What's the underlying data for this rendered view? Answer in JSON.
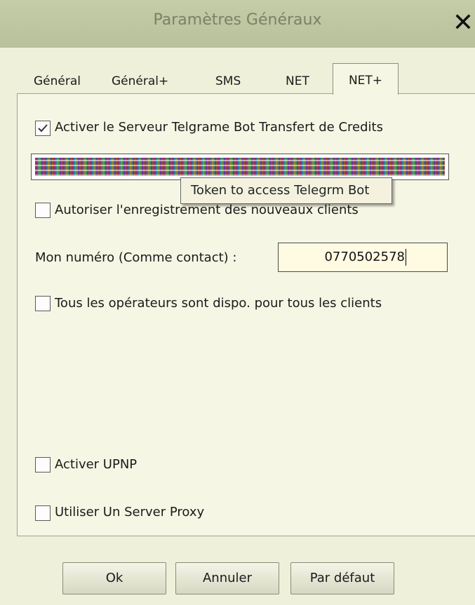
{
  "window": {
    "title": "Paramètres Généraux",
    "close_glyph": "✕"
  },
  "tabs": [
    {
      "label": "Général",
      "active": false
    },
    {
      "label": "Général+",
      "active": false
    },
    {
      "label": "SMS",
      "active": false
    },
    {
      "label": "NET",
      "active": false
    },
    {
      "label": "NET+",
      "active": true
    }
  ],
  "options": {
    "telegram_bot": {
      "label": "Activer le Serveur Telgrame Bot Transfert de Credits",
      "checked": true
    },
    "token_tooltip": "Token to access Telegrm Bot",
    "register_clients": {
      "label": "Autoriser l'enregistrement des nouveaux clients",
      "checked": false
    },
    "my_number": {
      "label": "Mon numéro (Comme contact) :",
      "value": "0770502578"
    },
    "all_operators": {
      "label": "Tous les opérateurs sont dispo. pour tous les clients",
      "checked": false
    },
    "upnp": {
      "label": "Activer UPNP",
      "checked": false
    },
    "proxy": {
      "label": "Utiliser Un Server Proxy",
      "checked": false
    }
  },
  "buttons": {
    "ok": "Ok",
    "cancel": "Annuler",
    "default": "Par défaut"
  },
  "colors": {
    "titlebar": "#b8c19a",
    "panel": "#f6f6e4",
    "input_highlight": "#fffbe2"
  }
}
